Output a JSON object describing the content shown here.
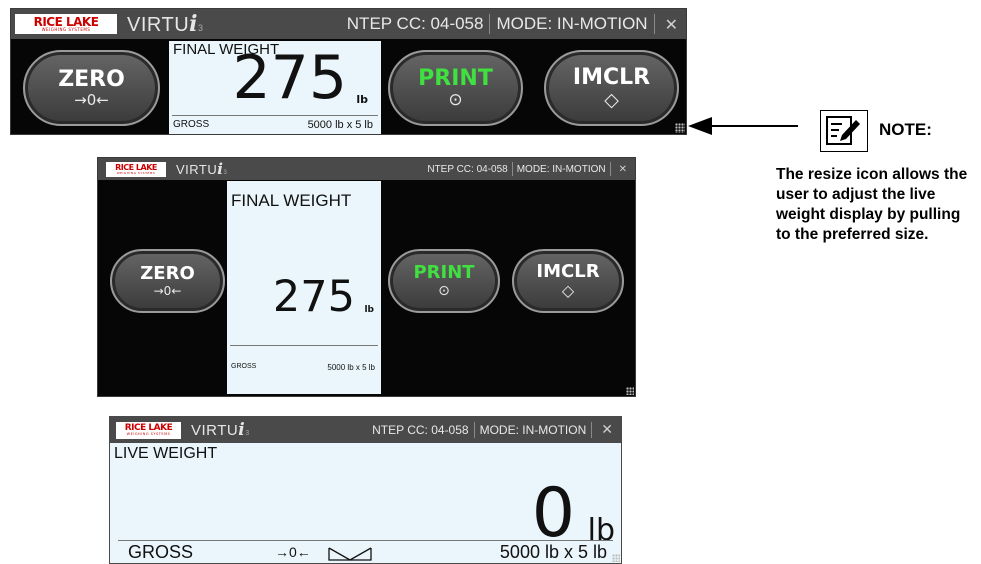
{
  "window1": {
    "logo": "RICE LAKE",
    "logo_sub": "WEIGHING SYSTEMS",
    "app": "VIRTU",
    "app_i": "i",
    "app_sup": "3",
    "ntep": "NTEP CC: 04-058",
    "mode": "MODE: IN-MOTION",
    "close": "✕",
    "zero_label": "ZERO",
    "zero_symbol": "→0←",
    "panel_title": "FINAL WEIGHT",
    "weight": "275",
    "unit": "lb",
    "gross": "GROSS",
    "capacity": "5000 lb x 5 lb",
    "print_label": "PRINT",
    "print_symbol": "⊙",
    "imclr_label": "IMCLR",
    "imclr_symbol": "◇"
  },
  "window2": {
    "logo": "RICE LAKE",
    "logo_sub": "WEIGHING SYSTEMS",
    "app": "VIRTU",
    "app_i": "i",
    "app_sup": "3",
    "ntep": "NTEP CC: 04-058",
    "mode": "MODE: IN-MOTION",
    "close": "✕",
    "zero_label": "ZERO",
    "zero_symbol": "→0←",
    "panel_title": "FINAL WEIGHT",
    "weight": "275",
    "unit": "lb",
    "gross": "GROSS",
    "capacity": "5000 lb x 5 lb",
    "print_label": "PRINT",
    "print_symbol": "⊙",
    "imclr_label": "IMCLR",
    "imclr_symbol": "◇"
  },
  "window3": {
    "logo": "RICE LAKE",
    "logo_sub": "WEIGHING SYSTEMS",
    "app": "VIRTU",
    "app_i": "i",
    "app_sup": "3",
    "ntep": "NTEP CC: 04-058",
    "mode": "MODE: IN-MOTION",
    "close": "✕",
    "panel_title": "LIVE WEIGHT",
    "weight": "0",
    "unit": "lb",
    "gross": "GROSS",
    "zero_symbol": "→0←",
    "capacity": "5000 lb x 5 lb"
  },
  "note": {
    "title": "NOTE:",
    "text": "The resize icon allows the user to adjust the live weight display by pulling to the preferred size."
  }
}
